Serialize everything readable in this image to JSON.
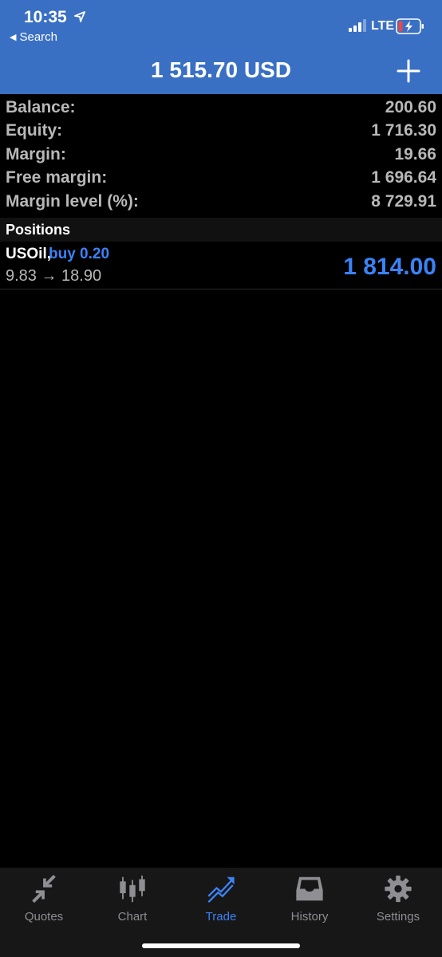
{
  "status_bar": {
    "time": "10:35",
    "back_label": "Search",
    "network": "LTE"
  },
  "nav": {
    "title": "1 515.70 USD",
    "add_icon": "plus-icon"
  },
  "summary": [
    {
      "label": "Balance:",
      "value": "200.60"
    },
    {
      "label": "Equity:",
      "value": "1 716.30"
    },
    {
      "label": "Margin:",
      "value": "19.66"
    },
    {
      "label": "Free margin:",
      "value": "1 696.64"
    },
    {
      "label": "Margin level (%):",
      "value": "8 729.91"
    }
  ],
  "positions": {
    "header": "Positions",
    "items": [
      {
        "symbol": "USOil,",
        "type": "buy 0.20",
        "prices": "9.83 → 18.90",
        "profit": "1 814.00"
      }
    ]
  },
  "tabs": [
    {
      "label": "Quotes",
      "icon": "quotes-arrows-icon"
    },
    {
      "label": "Chart",
      "icon": "candlestick-icon"
    },
    {
      "label": "Trade",
      "icon": "trade-trend-icon",
      "active": true
    },
    {
      "label": "History",
      "icon": "inbox-icon"
    },
    {
      "label": "Settings",
      "icon": "gear-icon"
    }
  ],
  "colors": {
    "header_bg": "#3a70c4",
    "accent_blue": "#3b82f6",
    "label_gray": "#b8b8b8",
    "tab_inactive": "#8e8e93"
  }
}
